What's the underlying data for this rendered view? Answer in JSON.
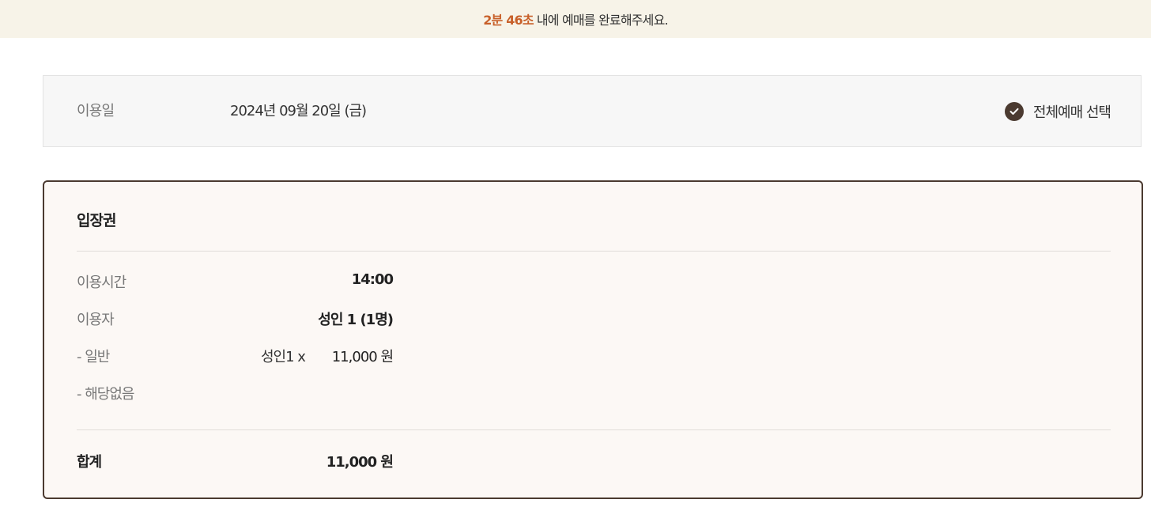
{
  "timer": {
    "time": "2분 46초",
    "message": "내에 예매를 완료해주세요."
  },
  "date_section": {
    "label": "이용일",
    "value": "2024년 09월 20일 (금)",
    "select_all_label": "전체예매 선택",
    "select_all_checked": true
  },
  "ticket": {
    "title": "입장권",
    "time_label": "이용시간",
    "time_value": "14:00",
    "user_label": "이용자",
    "user_value": "성인 1 (1명)",
    "general_label": "- 일반",
    "general_qty": "성인1 x",
    "general_price": "11,000 원",
    "none_label": "- 해당없음",
    "total_label": "합계",
    "total_value": "11,000 원"
  },
  "colors": {
    "accent": "#4b3a30",
    "timer_highlight": "#c8602a",
    "timer_bg": "#f7f3e8",
    "card_bg": "#fcf8f5"
  }
}
